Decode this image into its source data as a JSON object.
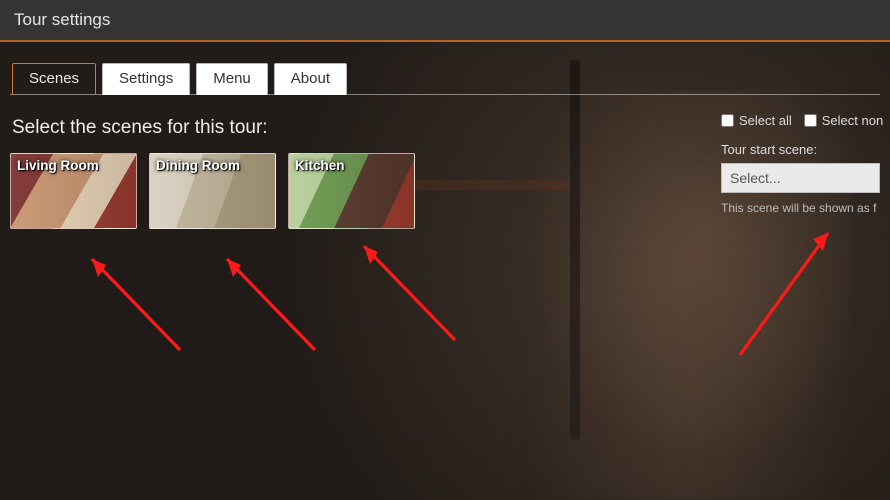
{
  "header": {
    "title": "Tour settings"
  },
  "tabs": [
    {
      "label": "Scenes",
      "active": true
    },
    {
      "label": "Settings",
      "active": false
    },
    {
      "label": "Menu",
      "active": false
    },
    {
      "label": "About",
      "active": false
    }
  ],
  "scenes_section": {
    "title": "Select the scenes for this tour:",
    "items": [
      {
        "label": "Living Room"
      },
      {
        "label": "Dining Room"
      },
      {
        "label": "Kitchen"
      }
    ]
  },
  "selection_controls": {
    "select_all": "Select all",
    "select_none": "Select non"
  },
  "start_scene": {
    "label": "Tour start scene:",
    "placeholder": "Select...",
    "hint": "This scene will be shown as f"
  },
  "accent_color": "#d07a2e"
}
